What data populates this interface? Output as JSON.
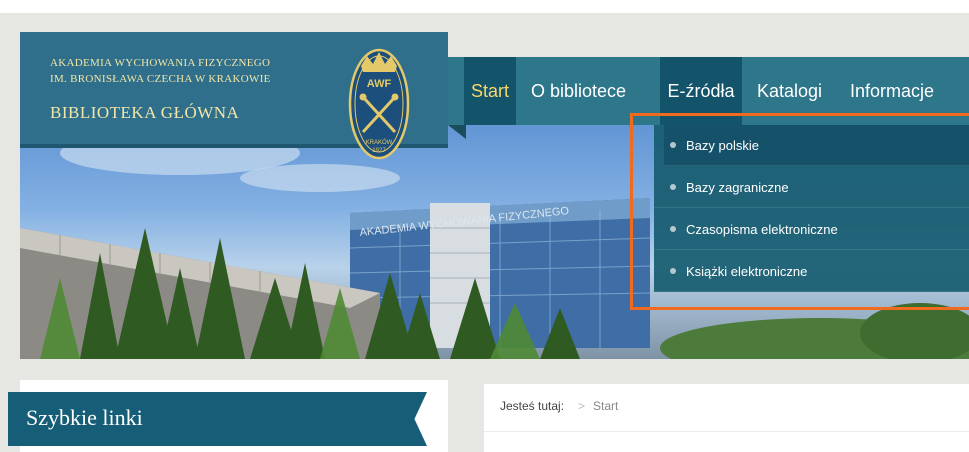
{
  "header": {
    "line1": "AKADEMIA WYCHOWANIA FIZYCZNEGO",
    "line2": "IM. BRONISŁAWA CZECHA W KRAKOWIE",
    "title": "BIBLIOTEKA GŁÓWNA",
    "logo": {
      "top_text": "AWF",
      "bottom_text": "KRAKÓW",
      "year": "1927"
    }
  },
  "nav": {
    "items": [
      {
        "label": "Start",
        "state": "active"
      },
      {
        "label": "O bibliotece"
      },
      {
        "label": "E-źródła",
        "state": "open"
      },
      {
        "label": "Katalogi"
      },
      {
        "label": "Informacje"
      }
    ]
  },
  "dropdown": {
    "items": [
      {
        "label": "Bazy polskie"
      },
      {
        "label": "Bazy zagraniczne"
      },
      {
        "label": "Czasopisma elektroniczne"
      },
      {
        "label": "Książki elektroniczne"
      }
    ]
  },
  "hero": {
    "building_sign": "AKADEMIA WYCHOWANIA FIZYCZNEGO"
  },
  "sidebar": {
    "title": "Szybkie linki"
  },
  "breadcrumb": {
    "prefix": "Jesteś tutaj:",
    "separator": ">",
    "current": "Start"
  },
  "colors": {
    "nav_bg": "#2e7689",
    "nav_active_bg": "#14546b",
    "nav_active_text": "#f7d86a",
    "header_text": "#f2e6a8",
    "highlight": "#f06a1f"
  }
}
